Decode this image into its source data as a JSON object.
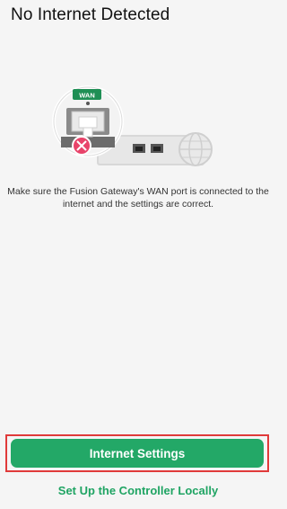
{
  "header": {
    "title": "No Internet Detected"
  },
  "illustration": {
    "port_badge": "WAN"
  },
  "message": "Make sure the Fusion Gateway's WAN port is connected to the internet and the settings are correct.",
  "actions": {
    "primary_label": "Internet Settings",
    "secondary_label": "Set Up the Controller Locally"
  },
  "colors": {
    "accent": "#23a867",
    "highlight_border": "#e03a3a",
    "error_badge": "#e8436a"
  }
}
